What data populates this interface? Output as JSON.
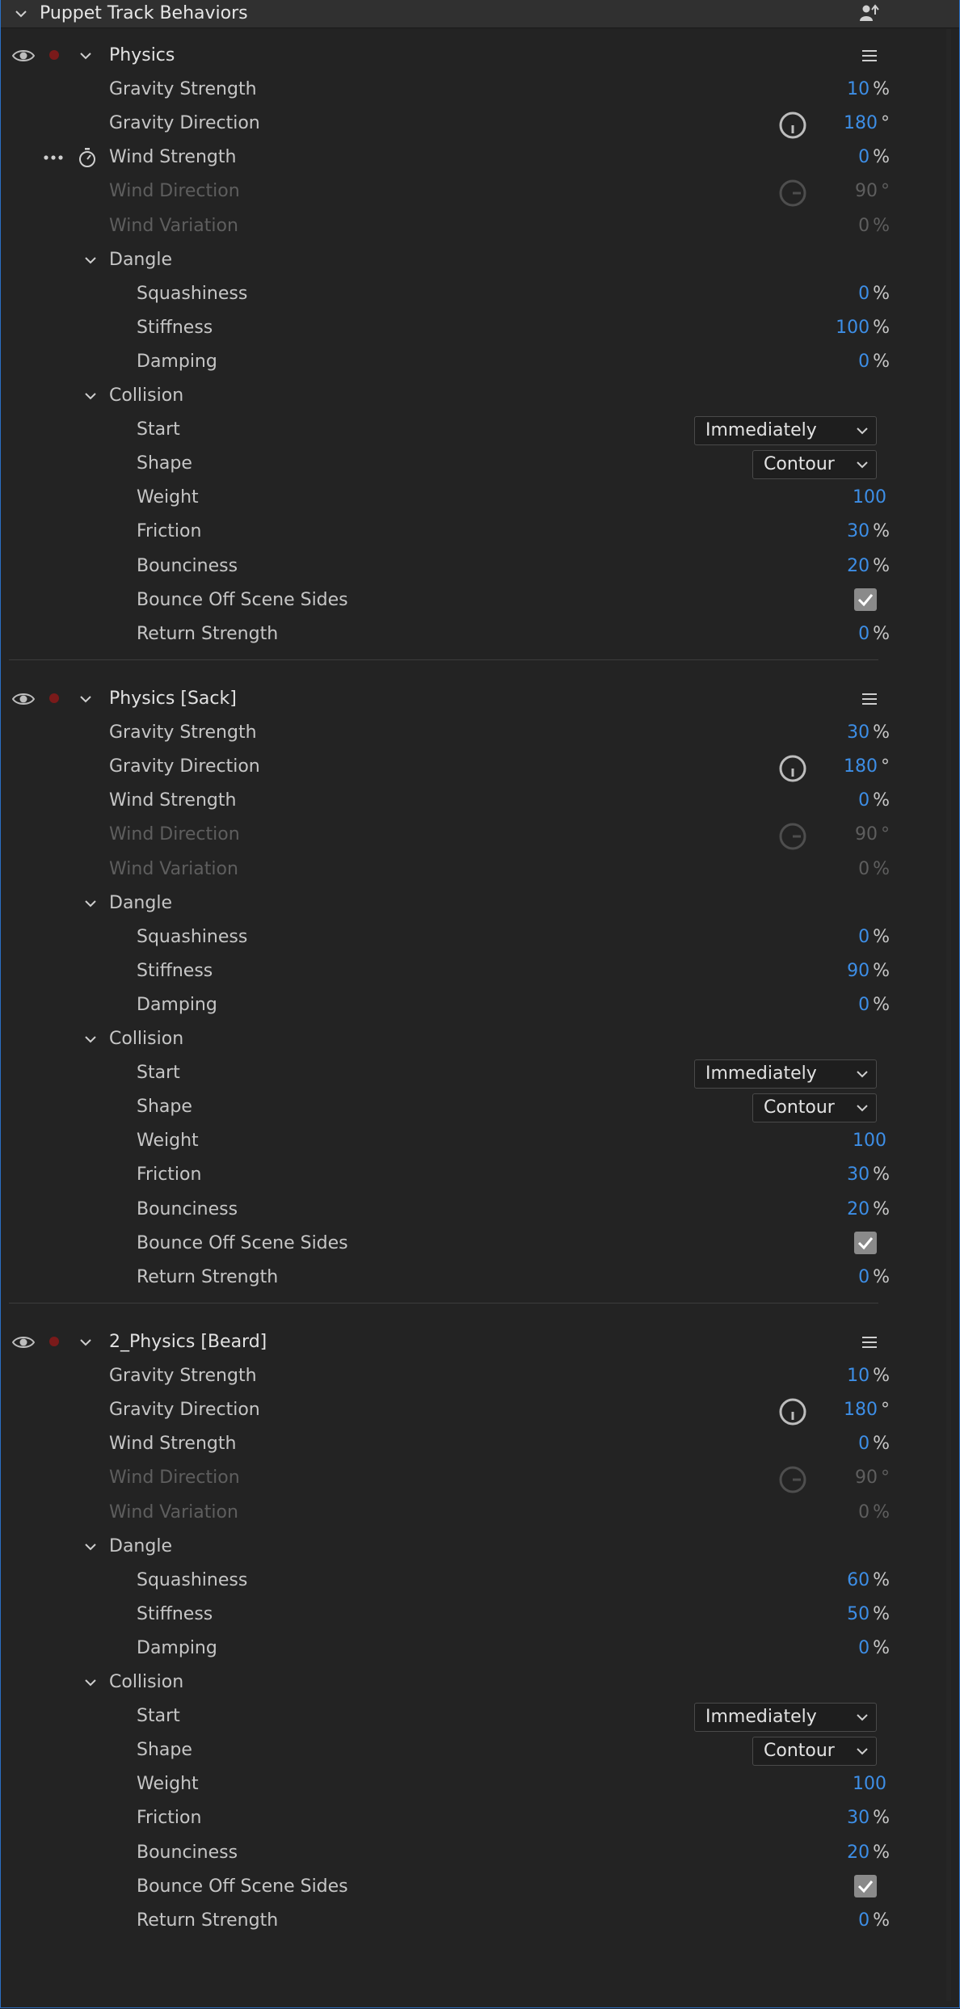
{
  "panel": {
    "title": "Puppet Track Behaviors"
  },
  "sections": [
    {
      "title": "Physics",
      "rows": [
        {
          "label": "Gravity Strength",
          "value": "10",
          "unit": "%"
        },
        {
          "label": "Gravity Direction",
          "value": "180",
          "unit": "°"
        },
        {
          "label": "Wind Strength",
          "value": "0",
          "unit": "%"
        },
        {
          "label": "Wind Direction",
          "value": "90",
          "unit": "°"
        },
        {
          "label": "Wind Variation",
          "value": "0",
          "unit": "%"
        }
      ],
      "dangle": {
        "title": "Dangle",
        "rows": [
          {
            "label": "Squashiness",
            "value": "0",
            "unit": "%"
          },
          {
            "label": "Stiffness",
            "value": "100",
            "unit": "%"
          },
          {
            "label": "Damping",
            "value": "0",
            "unit": "%"
          }
        ]
      },
      "collision": {
        "title": "Collision",
        "start_label": "Start",
        "start_value": "Immediately",
        "shape_label": "Shape",
        "shape_value": "Contour",
        "rows": [
          {
            "label": "Weight",
            "value": "100",
            "unit": ""
          },
          {
            "label": "Friction",
            "value": "30",
            "unit": "%"
          },
          {
            "label": "Bounciness",
            "value": "20",
            "unit": "%"
          }
        ],
        "bounce_label": "Bounce Off Scene Sides",
        "bounce_checked": true,
        "return_label": "Return Strength",
        "return_value": "0",
        "return_unit": "%"
      }
    },
    {
      "title": "Physics [Sack]",
      "rows": [
        {
          "label": "Gravity Strength",
          "value": "30",
          "unit": "%"
        },
        {
          "label": "Gravity Direction",
          "value": "180",
          "unit": "°"
        },
        {
          "label": "Wind Strength",
          "value": "0",
          "unit": "%"
        },
        {
          "label": "Wind Direction",
          "value": "90",
          "unit": "°"
        },
        {
          "label": "Wind Variation",
          "value": "0",
          "unit": "%"
        }
      ],
      "dangle": {
        "title": "Dangle",
        "rows": [
          {
            "label": "Squashiness",
            "value": "0",
            "unit": "%"
          },
          {
            "label": "Stiffness",
            "value": "90",
            "unit": "%"
          },
          {
            "label": "Damping",
            "value": "0",
            "unit": "%"
          }
        ]
      },
      "collision": {
        "title": "Collision",
        "start_label": "Start",
        "start_value": "Immediately",
        "shape_label": "Shape",
        "shape_value": "Contour",
        "rows": [
          {
            "label": "Weight",
            "value": "100",
            "unit": ""
          },
          {
            "label": "Friction",
            "value": "30",
            "unit": "%"
          },
          {
            "label": "Bounciness",
            "value": "20",
            "unit": "%"
          }
        ],
        "bounce_label": "Bounce Off Scene Sides",
        "bounce_checked": true,
        "return_label": "Return Strength",
        "return_value": "0",
        "return_unit": "%"
      }
    },
    {
      "title": "2_Physics [Beard]",
      "rows": [
        {
          "label": "Gravity Strength",
          "value": "10",
          "unit": "%"
        },
        {
          "label": "Gravity Direction",
          "value": "180",
          "unit": "°"
        },
        {
          "label": "Wind Strength",
          "value": "0",
          "unit": "%"
        },
        {
          "label": "Wind Direction",
          "value": "90",
          "unit": "°"
        },
        {
          "label": "Wind Variation",
          "value": "0",
          "unit": "%"
        }
      ],
      "dangle": {
        "title": "Dangle",
        "rows": [
          {
            "label": "Squashiness",
            "value": "60",
            "unit": "%"
          },
          {
            "label": "Stiffness",
            "value": "50",
            "unit": "%"
          },
          {
            "label": "Damping",
            "value": "0",
            "unit": "%"
          }
        ]
      },
      "collision": {
        "title": "Collision",
        "start_label": "Start",
        "start_value": "Immediately",
        "shape_label": "Shape",
        "shape_value": "Contour",
        "rows": [
          {
            "label": "Weight",
            "value": "100",
            "unit": ""
          },
          {
            "label": "Friction",
            "value": "30",
            "unit": "%"
          },
          {
            "label": "Bounciness",
            "value": "20",
            "unit": "%"
          }
        ],
        "bounce_label": "Bounce Off Scene Sides",
        "bounce_checked": true,
        "return_label": "Return Strength",
        "return_value": "0",
        "return_unit": "%"
      }
    }
  ],
  "icons": {
    "panel_collapse": "chevron-down-icon",
    "add_behavior": "add-behavior-icon",
    "visibility": "eye-icon",
    "record": "record-icon",
    "menu": "hamburger-menu-icon",
    "dial": "rotation-dial-icon",
    "more": "more-dots-icon",
    "stopwatch": "stopwatch-icon",
    "checkbox": "checkbox-icon"
  },
  "colors": {
    "accent": "#3d8ee6",
    "background": "#232323",
    "record": "#7a1a1a",
    "border": "#2a6fc4"
  }
}
